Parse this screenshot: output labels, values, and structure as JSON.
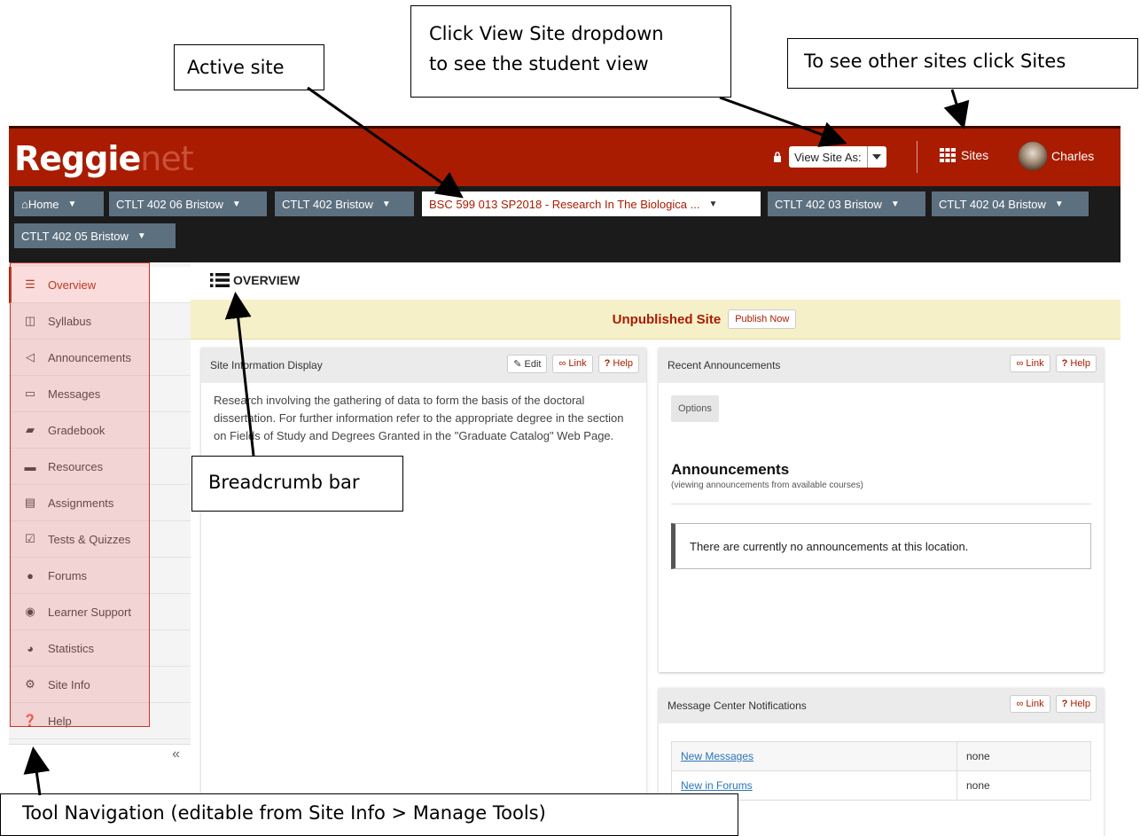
{
  "callouts": {
    "active_site": "Active site",
    "view_site_line1": "Click View Site dropdown",
    "view_site_line2": "to see the student view",
    "sites": "To see other sites click Sites",
    "breadcrumb": "Breadcrumb bar",
    "tool_nav": "Tool Navigation (editable from Site Info > Manage Tools)"
  },
  "header": {
    "logo_main": "Reggie",
    "logo_suffix": "net",
    "view_site_as": "View Site As:",
    "sites_label": "Sites",
    "user_name": "Charles",
    "accent_color": "#a91c01"
  },
  "site_tabs": [
    {
      "label": "Home"
    },
    {
      "label": "CTLT 402 06 Bristow"
    },
    {
      "label": "CTLT 402 Bristow"
    },
    {
      "label": "BSC 599 013 SP2018 - Research In The Biologica ...",
      "active": true
    },
    {
      "label": "CTLT 402 03 Bristow"
    },
    {
      "label": "CTLT 402 04 Bristow"
    },
    {
      "label": "CTLT 402 05 Bristow"
    }
  ],
  "tools": [
    {
      "label": "Overview",
      "icon": "list-icon",
      "active": true
    },
    {
      "label": "Syllabus",
      "icon": "map-icon"
    },
    {
      "label": "Announcements",
      "icon": "megaphone-icon"
    },
    {
      "label": "Messages",
      "icon": "inbox-icon"
    },
    {
      "label": "Gradebook",
      "icon": "book-icon"
    },
    {
      "label": "Resources",
      "icon": "folder-icon"
    },
    {
      "label": "Assignments",
      "icon": "file-icon"
    },
    {
      "label": "Tests & Quizzes",
      "icon": "checkbox-icon"
    },
    {
      "label": "Forums",
      "icon": "chat-icon"
    },
    {
      "label": "Learner Support",
      "icon": "globe-icon"
    },
    {
      "label": "Statistics",
      "icon": "pie-chart-icon"
    },
    {
      "label": "Site Info",
      "icon": "gear-icon"
    },
    {
      "label": "Help",
      "icon": "question-icon"
    }
  ],
  "collapse_label": "«",
  "main": {
    "breadcrumb": "OVERVIEW",
    "unpublished_text": "Unpublished Site",
    "publish_button": "Publish Now"
  },
  "site_info": {
    "title": "Site Information Display",
    "edit": "Edit",
    "link": "Link",
    "help": "Help",
    "text": "Research involving the gathering of data to form the basis of the doctoral dissertation. For further information refer to the appropriate degree in the section on Fields of Study and Degrees Granted in the \"Graduate Catalog\" Web Page."
  },
  "announcements": {
    "title": "Recent Announcements",
    "link": "Link",
    "help": "Help",
    "options": "Options",
    "heading": "Announcements",
    "sub": "(viewing announcements from available courses)",
    "empty": "There are currently no announcements at this location."
  },
  "message_center": {
    "title": "Message Center Notifications",
    "link": "Link",
    "help": "Help",
    "rows": [
      {
        "label": "New Messages",
        "value": "none"
      },
      {
        "label": "New in Forums",
        "value": "none"
      }
    ]
  }
}
